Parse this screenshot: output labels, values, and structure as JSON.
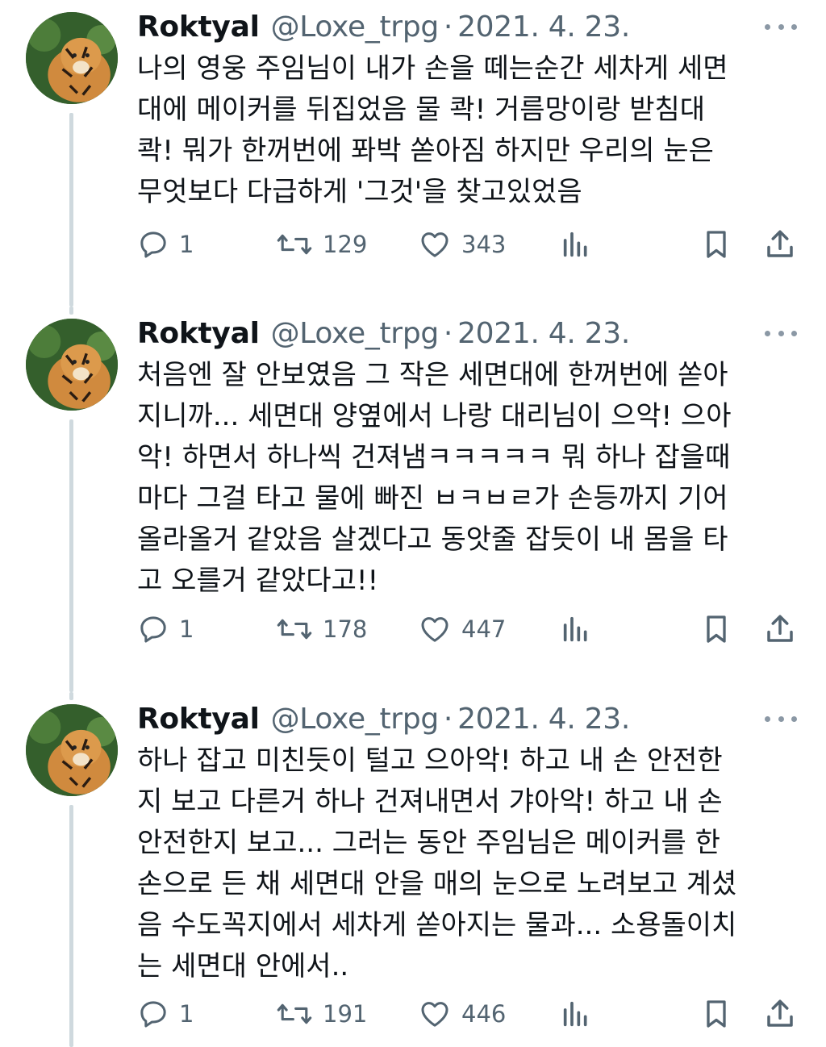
{
  "tweets": [
    {
      "name": "Roktyal",
      "handle": "@Loxe_trpg",
      "separator": "·",
      "date": "2021. 4. 23.",
      "text": "나의 영웅 주임님이 내가 손을 떼는순간 세차게 세면\n대에 메이커를 뒤집었음 물 콱! 거름망이랑 받침대\n콱! 뭐가 한꺼번에 퐈박 쏟아짐 하지만 우리의 눈은\n무엇보다 다급하게 '그것'을 찾고있었음",
      "replies": "1",
      "retweets": "129",
      "likes": "343"
    },
    {
      "name": "Roktyal",
      "handle": "@Loxe_trpg",
      "separator": "·",
      "date": "2021. 4. 23.",
      "text": "처음엔 잘 안보였음 그 작은 세면대에 한꺼번에 쏟아\n지니까... 세면대 양옆에서 나랑 대리님이 으악! 으아\n악! 하면서 하나씩 건져냄ㅋㅋㅋㅋㅋ 뭐 하나 잡을때\n마다 그걸 타고 물에 빠진 ㅂㅋㅂㄹ가 손등까지 기어\n올라올거 같았음 살겠다고 동앗줄 잡듯이 내 몸을 타\n고 오를거 같았다고!!",
      "replies": "1",
      "retweets": "178",
      "likes": "447"
    },
    {
      "name": "Roktyal",
      "handle": "@Loxe_trpg",
      "separator": "·",
      "date": "2021. 4. 23.",
      "text": "하나 잡고 미친듯이 털고 으아악! 하고 내 손 안전한\n지 보고 다른거 하나 건져내면서 갸아악! 하고 내 손\n안전한지 보고... 그러는 동안 주임님은 메이커를 한\n손으로 든 채 세면대 안을 매의 눈으로 노려보고 계셨\n음 수도꼭지에서 세차게 쏟아지는 물과... 소용돌이치\n는 세면대 안에서..",
      "replies": "1",
      "retweets": "191",
      "likes": "446"
    }
  ],
  "icons": {
    "avatar": "tiger-avatar",
    "reply": "reply-icon",
    "retweet": "retweet-icon",
    "like": "heart-icon",
    "views": "views-icon",
    "bookmark": "bookmark-icon",
    "share": "share-icon",
    "more": "more-icon"
  },
  "colors": {
    "text": "#0f1419",
    "secondary": "#536471",
    "thread_line": "#cfd9de"
  }
}
